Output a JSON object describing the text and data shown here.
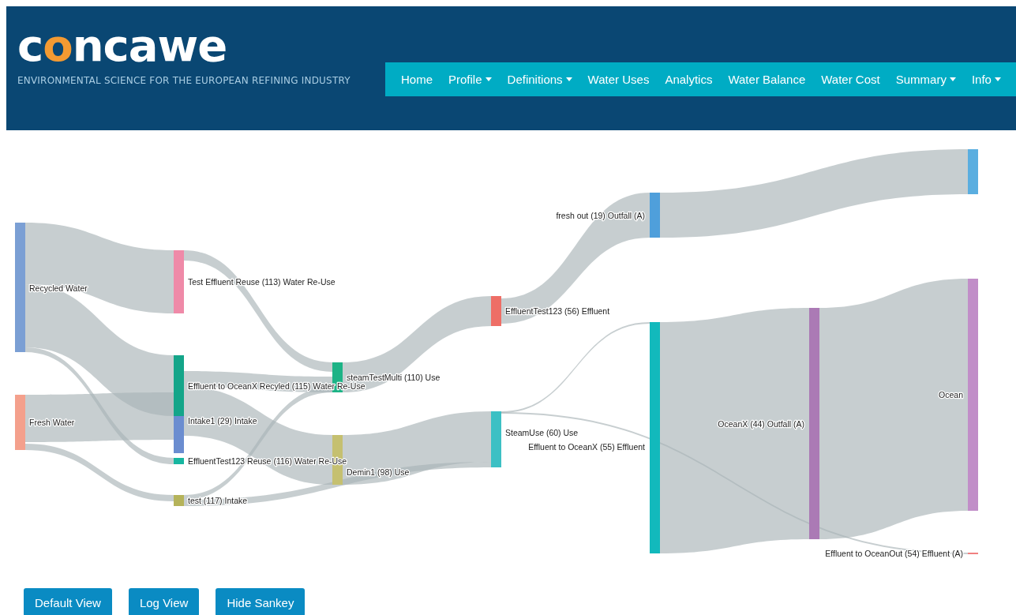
{
  "header": {
    "logo": [
      {
        "text": "c",
        "accent": false
      },
      {
        "text": "o",
        "accent": true
      },
      {
        "text": "ncawe",
        "accent": false
      }
    ],
    "tagline": "ENVIRONMENTAL SCIENCE FOR THE EUROPEAN REFINING INDUSTRY"
  },
  "nav": [
    {
      "label": "Home",
      "dropdown": false
    },
    {
      "label": "Profile",
      "dropdown": true
    },
    {
      "label": "Definitions",
      "dropdown": true
    },
    {
      "label": "Water Uses",
      "dropdown": false
    },
    {
      "label": "Analytics",
      "dropdown": false
    },
    {
      "label": "Water Balance",
      "dropdown": false
    },
    {
      "label": "Water Cost",
      "dropdown": false
    },
    {
      "label": "Summary",
      "dropdown": true
    },
    {
      "label": "Info",
      "dropdown": true
    }
  ],
  "sankey": {
    "nodes": [
      {
        "label": "Recycled Water",
        "color": "#7b9fd4"
      },
      {
        "label": "Fresh Water",
        "color": "#f4a08c"
      },
      {
        "label": "Test Effluent Reuse (113) Water Re-Use",
        "color": "#ef8aa8"
      },
      {
        "label": "Effluent to OceanX Recyled (115) Water Re-Use",
        "color": "#14a589"
      },
      {
        "label": "Intake1 (29) Intake",
        "color": "#6b8dd0"
      },
      {
        "label": "EffluentTest123 Reuse (116) Water Re-Use",
        "color": "#17b6a0"
      },
      {
        "label": "test (117) Intake",
        "color": "#b5b35a"
      },
      {
        "label": "steamTestMulti (110) Use",
        "color": "#1db386"
      },
      {
        "label": "Demin1 (98) Use",
        "color": "#c5c070"
      },
      {
        "label": "EffluentTest123 (56) Effluent",
        "color": "#ee6e66"
      },
      {
        "label": "SteamUse (60) Use",
        "color": "#3cc0c4"
      },
      {
        "label": "fresh out (19) Outfall (A)",
        "color": "#4f9fdb"
      },
      {
        "label": "Effluent to OceanX (55) Effluent",
        "color": "#12b9bc"
      },
      {
        "label": "OceanX (44) Outfall (A)",
        "color": "#ab7ab5"
      },
      {
        "label": "Ocean",
        "color": "#c18ec8"
      },
      {
        "color": "#5aaee0"
      },
      {
        "label": "Effluent to OceanOut (54) Effluent (A)",
        "color": "#f08080"
      }
    ]
  },
  "buttons": [
    "Default View",
    "Log View",
    "Hide Sankey"
  ]
}
